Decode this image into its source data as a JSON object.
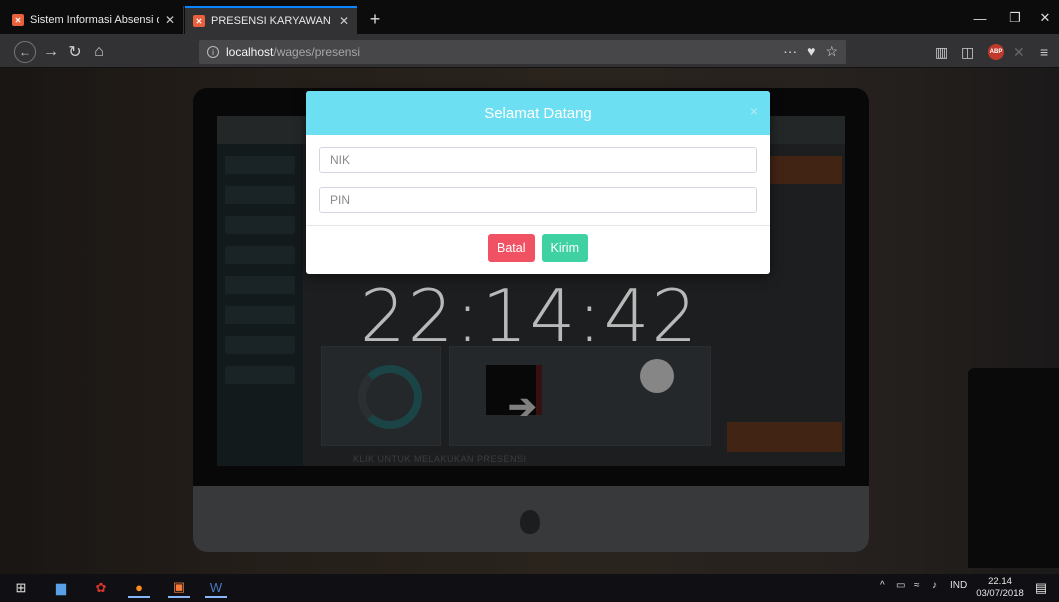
{
  "browser": {
    "tabs": [
      {
        "label": "Sistem Informasi Absensi dan P",
        "favicon": "xampp-icon",
        "active": false
      },
      {
        "label": "PRESENSI KARYAWAN",
        "favicon": "xampp-icon",
        "active": true
      }
    ],
    "new_tab": "+",
    "url": {
      "host": "localhost",
      "path": "/wages/presensi"
    },
    "more": "···"
  },
  "page": {
    "clock": "22:14:42",
    "caption": "KLIK UNTUK MELAKUKAN PRESENSI"
  },
  "modal": {
    "title": "Selamat Datang",
    "close": "×",
    "nik_placeholder": "NIK",
    "pin_placeholder": "PIN",
    "cancel_label": "Batal",
    "submit_label": "Kirim",
    "header_color": "#6ddff2",
    "cancel_color": "#f05163",
    "submit_color": "#3fd1a2"
  },
  "taskbar": {
    "language": "IND",
    "time": "22.14",
    "date": "03/07/2018"
  }
}
